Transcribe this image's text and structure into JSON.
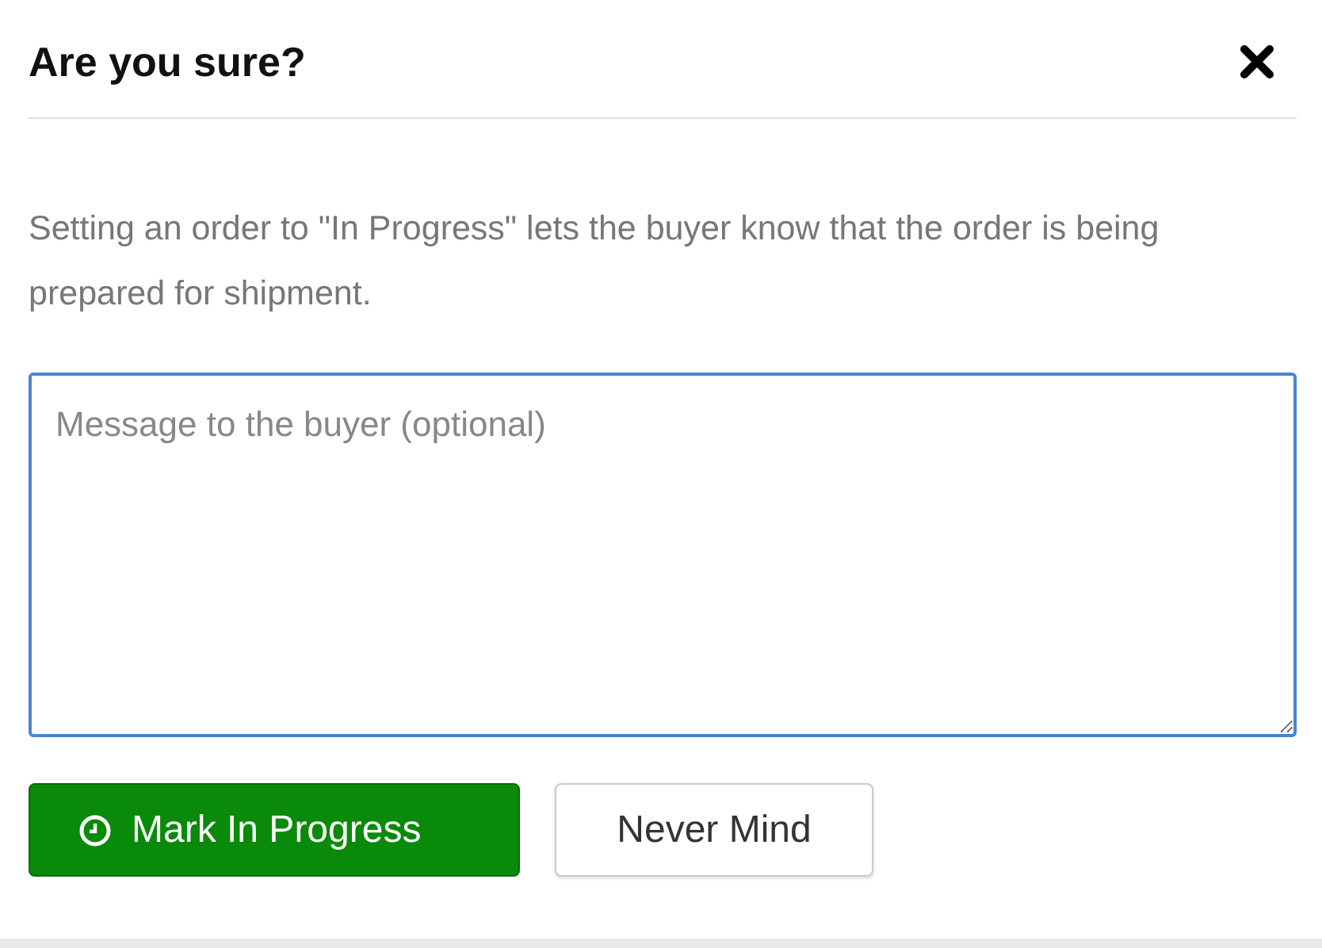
{
  "dialog": {
    "title": "Are you sure?",
    "message": "Setting an order to \"In Progress\" lets the buyer know that the order is being prepared for shipment.",
    "message_field": {
      "placeholder": "Message to the buyer (optional)"
    },
    "buttons": [
      {
        "label": "Mark In Progress",
        "kind": "primary"
      },
      {
        "label": "Never Mind",
        "kind": "default"
      }
    ]
  }
}
